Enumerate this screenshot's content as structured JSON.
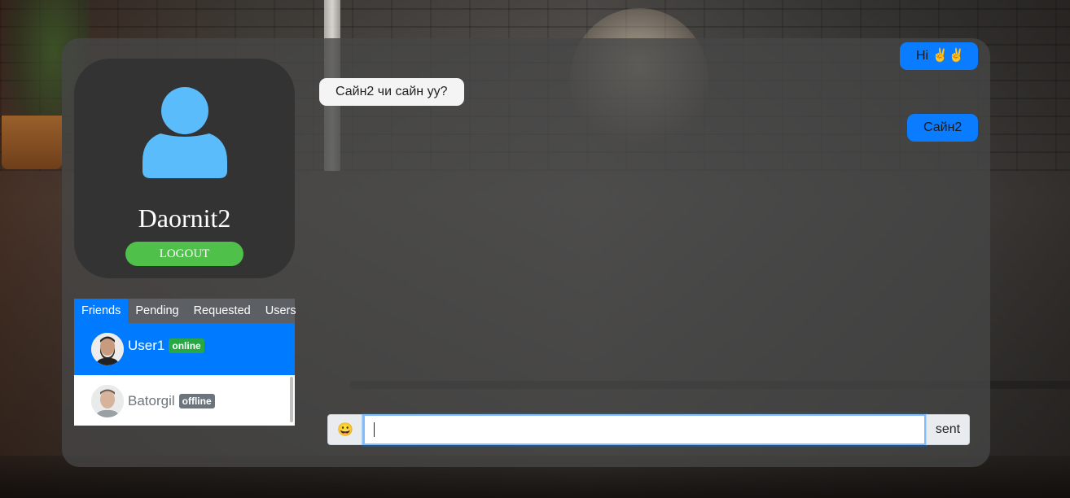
{
  "colors": {
    "accent": "#007bff",
    "online": "#28a745",
    "offline": "#6c757d",
    "logout": "#4fc04a",
    "avatar_icon": "#5bbcfb",
    "outgoing_bubble": "#0a7cff",
    "incoming_bubble": "#f4f4f4"
  },
  "profile": {
    "avatar_icon": "user-icon",
    "username": "Daornit2",
    "logout_label": "LOGOUT"
  },
  "tabs": [
    {
      "label": "Friends",
      "active": true
    },
    {
      "label": "Pending",
      "active": false
    },
    {
      "label": "Requested",
      "active": false
    },
    {
      "label": "Users",
      "active": false
    }
  ],
  "friends": [
    {
      "name": "User1",
      "status": "online",
      "selected": true
    },
    {
      "name": "Batorgil",
      "status": "offline",
      "selected": false
    }
  ],
  "messages": [
    {
      "text": "Hi ✌✌",
      "direction": "outgoing"
    },
    {
      "text": "Сайн2 чи сайн уу?",
      "direction": "incoming"
    },
    {
      "text": "Сайн2",
      "direction": "outgoing"
    }
  ],
  "composer": {
    "emoji_button": "😀",
    "input_value": "",
    "send_label": "sent"
  }
}
